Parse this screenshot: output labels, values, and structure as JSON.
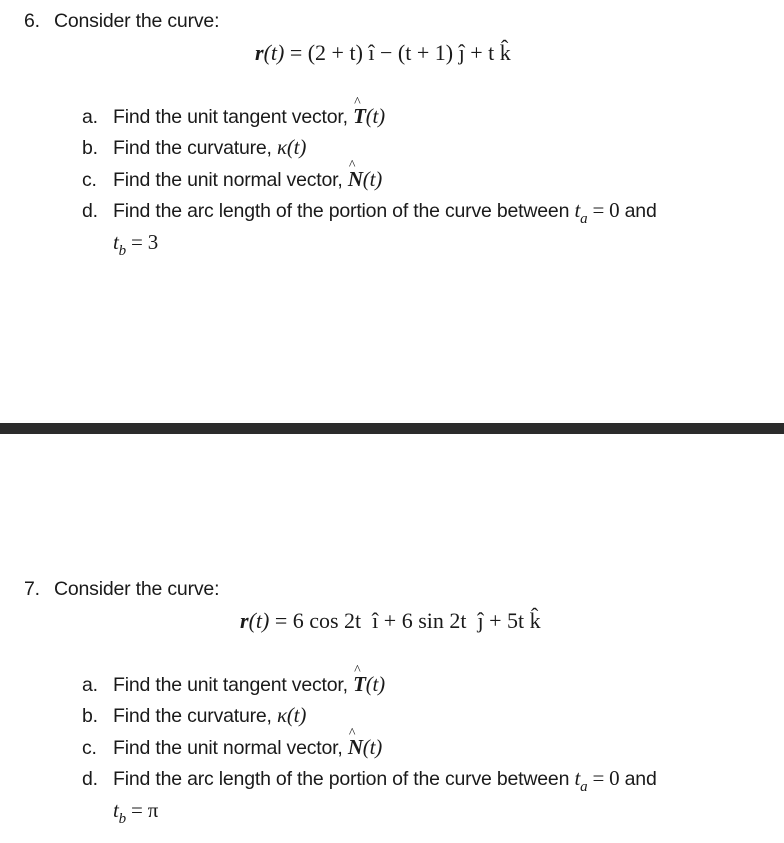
{
  "problems": [
    {
      "number": "6.",
      "heading": "Consider the curve:",
      "equation": {
        "lhs_vec": "r",
        "lhs_arg": "(t)",
        "rhs": " = (2 + t) î − (t + 1) ĵ + t k̂"
      },
      "parts": [
        {
          "letter": "a.",
          "text": "Find the unit tangent vector, ",
          "symbol": "T",
          "hat": "^",
          "arg": "(t)"
        },
        {
          "letter": "b.",
          "text": "Find the curvature, ",
          "symbol": "κ",
          "arg": "(t)"
        },
        {
          "letter": "c.",
          "text": "Find the unit normal vector, ",
          "symbol": "N",
          "hat": "^",
          "arg": "(t)"
        },
        {
          "letter": "d.",
          "text": "Find the arc length of the portion of the curve between ",
          "ta_var": "t",
          "ta_sub": "a",
          "ta_eq": " = 0",
          "and": " and",
          "tb_var": "t",
          "tb_sub": "b",
          "tb_eq": " = 3"
        }
      ]
    },
    {
      "number": "7.",
      "heading": "Consider the curve:",
      "equation": {
        "lhs_vec": "r",
        "lhs_arg": "(t)",
        "rhs": " = 6 cos 2t  î + 6 sin 2t  ĵ + 5t k̂"
      },
      "parts": [
        {
          "letter": "a.",
          "text": "Find the unit tangent vector, ",
          "symbol": "T",
          "hat": "^",
          "arg": "(t)"
        },
        {
          "letter": "b.",
          "text": "Find the curvature, ",
          "symbol": "κ",
          "arg": "(t)"
        },
        {
          "letter": "c.",
          "text": "Find the unit normal vector, ",
          "symbol": "N",
          "hat": "^",
          "arg": "(t)"
        },
        {
          "letter": "d.",
          "text": "Find the arc length of the portion of the curve between ",
          "ta_var": "t",
          "ta_sub": "a",
          "ta_eq": " = 0",
          "and": " and",
          "tb_var": "t",
          "tb_sub": "b",
          "tb_eq": " = π"
        }
      ]
    }
  ],
  "colors": {
    "text": "#1a1a1a",
    "divider": "#2b2b2b",
    "background": "#ffffff"
  }
}
